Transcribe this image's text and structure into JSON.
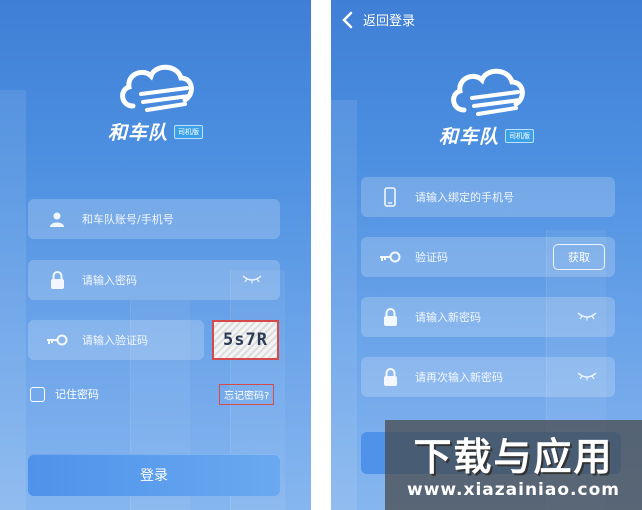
{
  "login_screen": {
    "brand": "和车队",
    "brand_tag": "司机版",
    "account_placeholder": "和车队账号/手机号",
    "password_placeholder": "请输入密码",
    "code_placeholder": "请输入验证码",
    "captcha_text": "5s7R",
    "remember_label": "记住密码",
    "forgot_label": "忘记密码?",
    "login_label": "登录"
  },
  "reset_screen": {
    "back_label": "返回登录",
    "brand": "和车队",
    "brand_tag": "司机版",
    "phone_placeholder": "请输入绑定的手机号",
    "code_placeholder": "验证码",
    "get_code_label": "获取",
    "new_password_placeholder": "请输入新密码",
    "confirm_password_placeholder": "请再次输入新密码"
  },
  "watermark": {
    "text": "下载与应用",
    "url": "www.xiazainiao.com"
  },
  "icons": {
    "user": "user-icon",
    "lock": "lock-icon",
    "key": "key-icon",
    "eye": "eye-closed-icon",
    "phone": "phone-icon",
    "back": "chevron-left-icon",
    "logo": "cloud-logo-icon"
  },
  "colors": {
    "gradient_top": "#3f7fd6",
    "gradient_bottom": "#86b6ef",
    "button": "#4e92ea",
    "highlight": "#d84a4a"
  }
}
